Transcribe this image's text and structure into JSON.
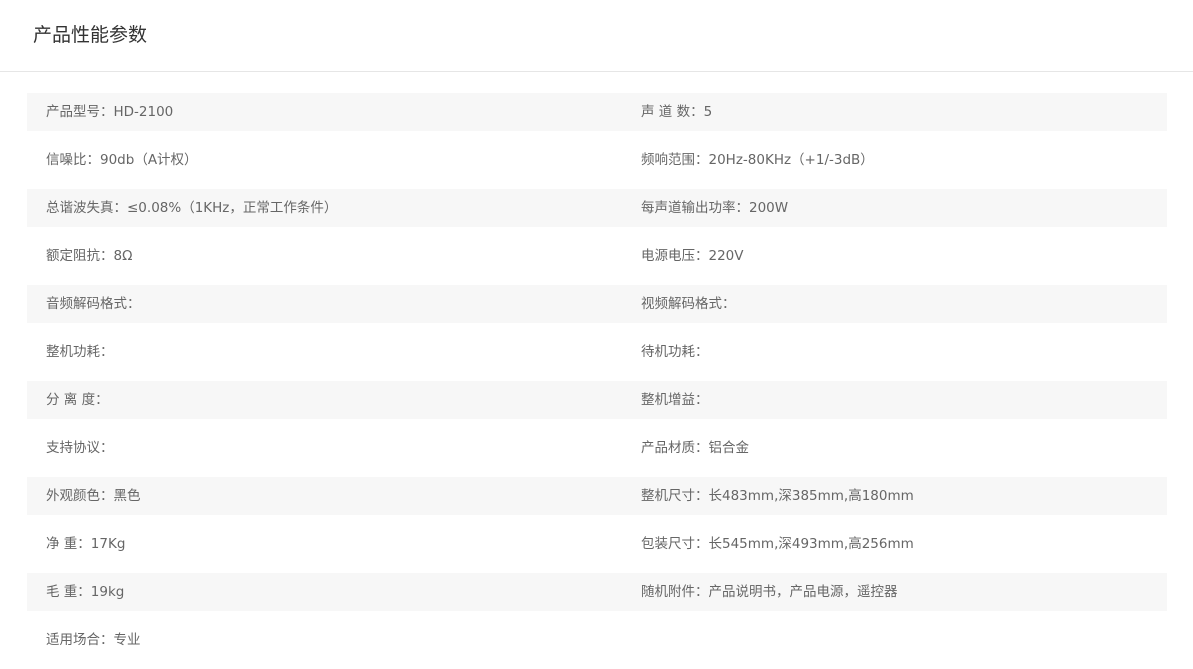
{
  "header": {
    "title": "产品性能参数"
  },
  "specs": [
    {
      "left": "产品型号：HD-2100",
      "right": "声 道 数：5"
    },
    {
      "left": "信噪比：90db（A计权）",
      "right": "频响范围：20Hz-80KHz（+1/-3dB）"
    },
    {
      "left": "总谐波失真：≤0.08%（1KHz，正常工作条件）",
      "right": "每声道输出功率：200W"
    },
    {
      "left": "额定阻抗：8Ω",
      "right": "电源电压：220V"
    },
    {
      "left": "音频解码格式：",
      "right": "视频解码格式："
    },
    {
      "left": "整机功耗：",
      "right": "待机功耗："
    },
    {
      "left": "分 离 度：",
      "right": "整机增益："
    },
    {
      "left": "支持协议：",
      "right": "产品材质：铝合金"
    },
    {
      "left": "外观颜色：黑色",
      "right": "整机尺寸：长483mm,深385mm,高180mm"
    },
    {
      "left": "净 重：17Kg",
      "right": "包装尺寸：长545mm,深493mm,高256mm"
    },
    {
      "left": "毛 重：19kg",
      "right": "随机附件：产品说明书，产品电源，遥控器"
    },
    {
      "left": "适用场合：专业",
      "right": ""
    }
  ]
}
